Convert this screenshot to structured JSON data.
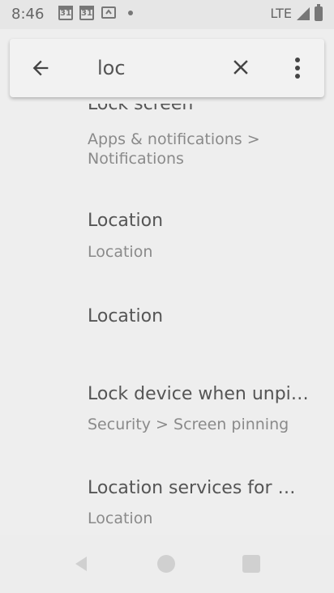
{
  "status_bar": {
    "time": "8:46",
    "calendar_day_1": "31",
    "calendar_day_2": "31",
    "network": "LTE"
  },
  "search": {
    "query": "loc",
    "back_icon": "arrow-back-icon",
    "clear_icon": "close-icon",
    "more_icon": "more-vert-icon"
  },
  "results": [
    {
      "title": "Lock screen",
      "subtitle": "Apps & notifications > Notifications"
    },
    {
      "title": "Location",
      "subtitle": "Location"
    },
    {
      "title": "Location",
      "subtitle": ""
    },
    {
      "title": "Lock device when unpinning",
      "subtitle": "Security > Screen pinning"
    },
    {
      "title": "Location services for work",
      "subtitle": "Location"
    }
  ],
  "nav_bar": {
    "back_icon": "nav-back-icon",
    "home_icon": "nav-home-icon",
    "recents_icon": "nav-recents-icon"
  }
}
